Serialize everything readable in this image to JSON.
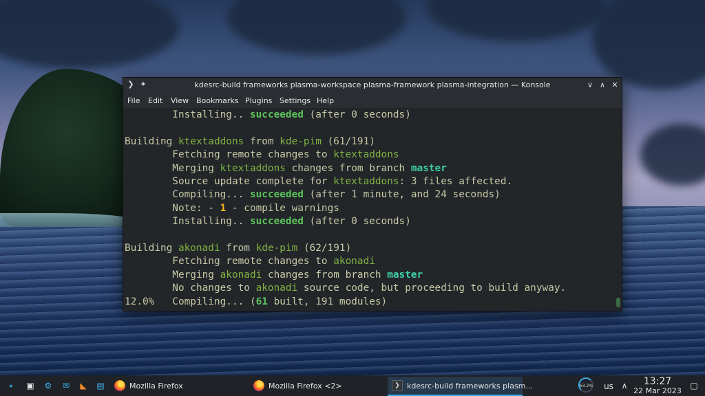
{
  "window": {
    "title": "kdesrc-build frameworks plasma-workspace plasma-framework plasma-integration — Konsole",
    "menu": [
      "File",
      "Edit",
      "View",
      "Bookmarks",
      "Plugins",
      "Settings",
      "Help"
    ]
  },
  "terminal": {
    "lines": [
      [
        {
          "t": "        Installing.. "
        },
        {
          "t": "succeeded",
          "c": "ok"
        },
        {
          "t": " (after 0 seconds)"
        }
      ],
      [],
      [
        {
          "t": "Building "
        },
        {
          "t": "ktextaddons",
          "c": "hl"
        },
        {
          "t": " from "
        },
        {
          "t": "kde-pim",
          "c": "hl"
        },
        {
          "t": " (61/191)"
        }
      ],
      [
        {
          "t": "        Fetching remote changes to "
        },
        {
          "t": "ktextaddons",
          "c": "hl"
        }
      ],
      [
        {
          "t": "        Merging "
        },
        {
          "t": "ktextaddons",
          "c": "hl"
        },
        {
          "t": " changes from branch "
        },
        {
          "t": "master",
          "c": "br"
        }
      ],
      [
        {
          "t": "        Source update complete for "
        },
        {
          "t": "ktextaddons",
          "c": "hl"
        },
        {
          "t": ": 3 files affected."
        }
      ],
      [
        {
          "t": "        Compiling... "
        },
        {
          "t": "succeeded",
          "c": "ok"
        },
        {
          "t": " (after 1 minute, and 24 seconds)"
        }
      ],
      [
        {
          "t": "        Note: - "
        },
        {
          "t": "1",
          "c": "warn"
        },
        {
          "t": " - compile warnings"
        }
      ],
      [
        {
          "t": "        Installing.. "
        },
        {
          "t": "succeeded",
          "c": "ok"
        },
        {
          "t": " (after 0 seconds)"
        }
      ],
      [],
      [
        {
          "t": "Building "
        },
        {
          "t": "akonadi",
          "c": "hl"
        },
        {
          "t": " from "
        },
        {
          "t": "kde-pim",
          "c": "hl"
        },
        {
          "t": " (62/191)"
        }
      ],
      [
        {
          "t": "        Fetching remote changes to "
        },
        {
          "t": "akonadi",
          "c": "hl"
        }
      ],
      [
        {
          "t": "        Merging "
        },
        {
          "t": "akonadi",
          "c": "hl"
        },
        {
          "t": " changes from branch "
        },
        {
          "t": "master",
          "c": "br"
        }
      ],
      [
        {
          "t": "        No changes to "
        },
        {
          "t": "akonadi",
          "c": "hl"
        },
        {
          "t": " source code, but proceeding to build anyway."
        }
      ],
      [
        {
          "t": "12.0%   Compiling... ("
        },
        {
          "t": "61",
          "c": "ok"
        },
        {
          "t": " built, 191 modules)"
        }
      ]
    ]
  },
  "taskbar": {
    "tasks": [
      {
        "label": "Mozilla Firefox",
        "icon": "firefox-icon"
      },
      {
        "label": "Mozilla Firefox <2>",
        "icon": "firefox-icon"
      },
      {
        "label": "kdesrc-build frameworks plasm...",
        "icon": "konsole-icon",
        "active": true
      }
    ],
    "gauge_label": "63.2%",
    "keyboard_layout": "us",
    "time": "13:27",
    "date": "22 Mar 2023"
  },
  "colors": {
    "accent": "#3daee9",
    "module_name": "#7fb342",
    "success": "#5cc35c",
    "branch": "#3dd1a8",
    "warning": "#f3b418"
  }
}
